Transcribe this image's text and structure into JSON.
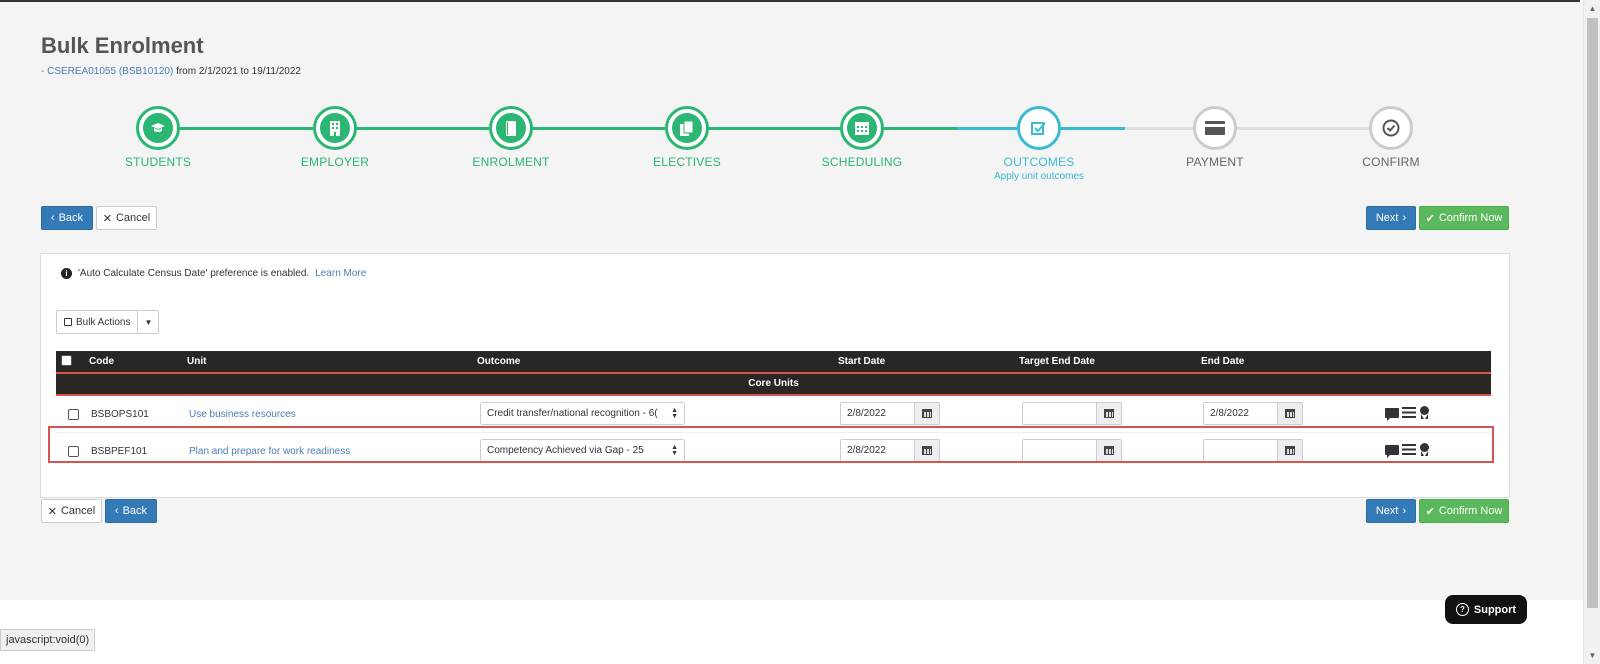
{
  "page": {
    "title": "Bulk Enrolment",
    "subtitle_link": "- CSEREA01055 (BSB10120)",
    "subtitle_rest": " from 2/1/2021 to 19/11/2022"
  },
  "steps": [
    {
      "label": "STUDENTS",
      "state": "done",
      "icon": "graduation-cap-icon"
    },
    {
      "label": "EMPLOYER",
      "state": "done",
      "icon": "building-icon"
    },
    {
      "label": "ENROLMENT",
      "state": "done",
      "icon": "book-icon"
    },
    {
      "label": "ELECTIVES",
      "state": "done",
      "icon": "copy-icon"
    },
    {
      "label": "SCHEDULING",
      "state": "done",
      "icon": "calendar-icon"
    },
    {
      "label": "OUTCOMES",
      "state": "active",
      "icon": "check-square-icon",
      "sub": "Apply unit outcomes"
    },
    {
      "label": "PAYMENT",
      "state": "todo",
      "icon": "credit-card-icon"
    },
    {
      "label": "CONFIRM",
      "state": "todo",
      "icon": "check-circle-icon"
    }
  ],
  "buttons": {
    "back": "Back",
    "cancel": "Cancel",
    "next": "Next",
    "confirm_now": "Confirm Now"
  },
  "notice": {
    "text": "'Auto Calculate Census Date' preference is enabled.",
    "link": "Learn More"
  },
  "bulk_actions": "Bulk Actions",
  "table": {
    "headers": [
      "Code",
      "Unit",
      "Outcome",
      "Start Date",
      "Target End Date",
      "End Date"
    ],
    "group": "Core Units",
    "rows": [
      {
        "code": "BSBOPS101",
        "unit": "Use business resources",
        "outcome": "Credit transfer/national recognition - 6(",
        "start": "2/8/2022",
        "target_end": "",
        "end": "2/8/2022"
      },
      {
        "code": "BSBPEF101",
        "unit": "Plan and prepare for work readiness",
        "outcome": "Competency Achieved via Gap - 25",
        "start": "2/8/2022",
        "target_end": "",
        "end": ""
      }
    ]
  },
  "support": "Support",
  "status_bar": "javascript:void(0)",
  "colors": {
    "done": "#2bb673",
    "active": "#3bbad1",
    "primary": "#337ab7",
    "success": "#5cb85c",
    "highlight": "#d9534f"
  }
}
